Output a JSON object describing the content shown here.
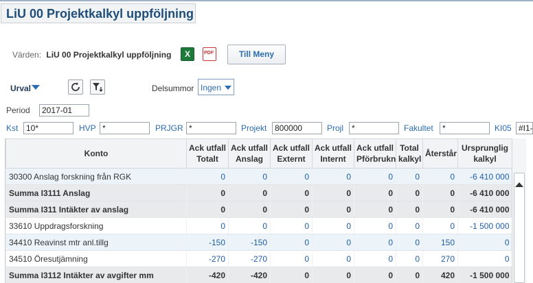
{
  "title": "LiU 00 Projektkalkyl uppföljning",
  "vardehallare": {
    "label": "Värden:",
    "value": "LiU 00 Projektkalkyl uppföljning"
  },
  "toolbar": {
    "excel_icon": "excel-icon",
    "pdf_icon": "pdf-icon",
    "menu_label": "Till Meny"
  },
  "urval": {
    "label": "Urval",
    "delsummor_label": "Delsummor",
    "delsummor_value": "Ingen"
  },
  "period": {
    "label": "Period",
    "value": "2017-01"
  },
  "filters": [
    {
      "label": "Kst",
      "value": "10*"
    },
    {
      "label": "HVP",
      "value": "*"
    },
    {
      "label": "PRJGR",
      "value": "*"
    },
    {
      "label": "Projekt",
      "value": "800000"
    },
    {
      "label": "Projl",
      "value": "*"
    },
    {
      "label": "Fakultet",
      "value": "*"
    },
    {
      "label": "KI05",
      "value": "#I1-"
    }
  ],
  "table": {
    "headers": [
      [
        "",
        "Konto"
      ],
      [
        "Ack utfall",
        "Totalt"
      ],
      [
        "Ack utfall",
        "Anslag"
      ],
      [
        "Ack utfall",
        "Externt"
      ],
      [
        "Ack utfall",
        "Internt"
      ],
      [
        "Ack utfall",
        "Pförbrukn"
      ],
      [
        "Total",
        "kalkyl"
      ],
      [
        "",
        "Återstår"
      ],
      [
        "Ursprunglig",
        "kalkyl"
      ]
    ],
    "rows": [
      {
        "type": "alt",
        "cells": [
          "30300 Anslag forskning från RGK",
          "0",
          "0",
          "0",
          "0",
          "0",
          "0",
          "0",
          "-6 410 000"
        ]
      },
      {
        "type": "sum",
        "cells": [
          "Summa I3111 Anslag",
          "0",
          "0",
          "0",
          "0",
          "0",
          "0",
          "0",
          "-6 410 000"
        ]
      },
      {
        "type": "sum",
        "cells": [
          "Summa I311 Intäkter av anslag",
          "0",
          "0",
          "0",
          "0",
          "0",
          "0",
          "0",
          "-6 410 000"
        ]
      },
      {
        "type": "normal",
        "cells": [
          "33610 Uppdragsforskning",
          "0",
          "0",
          "0",
          "0",
          "0",
          "0",
          "0",
          "-1 500 000"
        ]
      },
      {
        "type": "alt",
        "cells": [
          "34410 Reavinst mtr anl.tillg",
          "-150",
          "-150",
          "0",
          "0",
          "0",
          "0",
          "150",
          "0"
        ]
      },
      {
        "type": "normal",
        "cells": [
          "34510 Öresutjämning",
          "-270",
          "-270",
          "0",
          "0",
          "0",
          "0",
          "270",
          "0"
        ]
      },
      {
        "type": "sum",
        "cells": [
          "Summa I3112 Intäkter av avgifter mm",
          "-420",
          "-420",
          "0",
          "0",
          "0",
          "0",
          "420",
          "-1 500 000"
        ]
      }
    ]
  }
}
